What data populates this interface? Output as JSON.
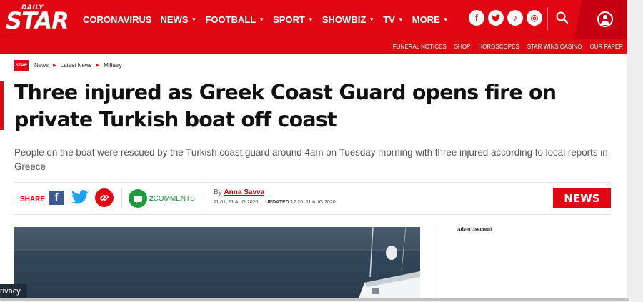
{
  "brand": {
    "daily": "DAILY",
    "star": "STAR"
  },
  "nav": {
    "items": [
      {
        "label": "CORONAVIRUS",
        "dropdown": false
      },
      {
        "label": "NEWS",
        "dropdown": true
      },
      {
        "label": "FOOTBALL",
        "dropdown": true
      },
      {
        "label": "SPORT",
        "dropdown": true
      },
      {
        "label": "SHOWBIZ",
        "dropdown": true
      },
      {
        "label": "TV",
        "dropdown": true
      },
      {
        "label": "MORE",
        "dropdown": true
      }
    ],
    "caret": "▼",
    "social": [
      "f",
      "t",
      "♪",
      "◎"
    ]
  },
  "subnav": {
    "items": [
      "FUNERAL NOTICES",
      "SHOP",
      "HOROSCOPES",
      "STAR WINS CASINO",
      "OUR PAPER"
    ]
  },
  "breadcrumb": {
    "logo": "STAR",
    "items": [
      "News",
      "Latest News",
      "Military"
    ],
    "sep": "▶"
  },
  "article": {
    "headline": "Three injured as Greek Coast Guard opens fire on private Turkish boat off coast",
    "standfirst": "People on the boat were rescued by the Turkish coast guard around 4am on Tuesday morning with three injured according to local reports in Greece",
    "share_label": "SHARE",
    "comments_count": "2",
    "comments_label": "COMMENTS",
    "by": "By",
    "author": "Anna Savva",
    "published": "11:01, 11 AUG 2020",
    "updated_label": "UPDATED",
    "updated": "12:20, 11 AUG 2020",
    "section_badge": "NEWS"
  },
  "sidebar": {
    "advert_label": "Advertisement"
  },
  "privacy": {
    "label": "rivacy"
  },
  "colors": {
    "brand_red": "#e10712",
    "comments_green": "#1c9b3b",
    "facebook_blue": "#3b5998",
    "twitter_blue": "#1da1f2"
  }
}
